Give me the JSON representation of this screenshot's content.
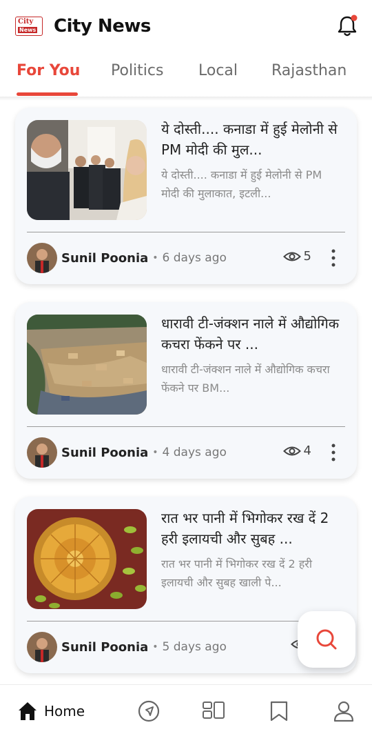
{
  "header": {
    "logo_line1": "City",
    "logo_line2": "News",
    "title": "City News"
  },
  "tabs": [
    {
      "label": "For You",
      "active": true
    },
    {
      "label": "Politics",
      "active": false
    },
    {
      "label": "Local",
      "active": false
    },
    {
      "label": "Rajasthan",
      "active": false
    }
  ],
  "articles": [
    {
      "title": "ये दोस्ती.... कनाडा में हुई मेलोनी से PM मोदी की मुल...",
      "excerpt": "ये दोस्ती.... कनाडा में हुई मेलोनी से PM मोदी की मुलाकात, इटली...",
      "author": "Sunil Poonia",
      "time": "6 days ago",
      "views": "5"
    },
    {
      "title": "धारावी टी-जंक्शन नाले में औद्योगिक कचरा फेंकने पर ...",
      "excerpt": "धारावी टी-जंक्शन नाले में औद्योगिक कचरा फेंकने पर BM...",
      "author": "Sunil Poonia",
      "time": "4 days ago",
      "views": "4"
    },
    {
      "title": "रात भर पानी में भिगोकर रख दें 2 हरी इलायची और सुबह ...",
      "excerpt": "रात भर पानी में भिगोकर रख दें 2 हरी इलायची और सुबह खाली पे...",
      "author": "Sunil Poonia",
      "time": "5 days ago",
      "views": ""
    }
  ],
  "bottom_nav": {
    "home_label": "Home"
  },
  "colors": {
    "accent": "#e8473a",
    "card_bg": "#f6f8fb"
  },
  "icons": [
    "bell-icon",
    "eye-icon",
    "more-vertical-icon",
    "search-icon",
    "home-icon",
    "compass-icon",
    "layout-icon",
    "bookmark-icon",
    "profile-icon"
  ]
}
